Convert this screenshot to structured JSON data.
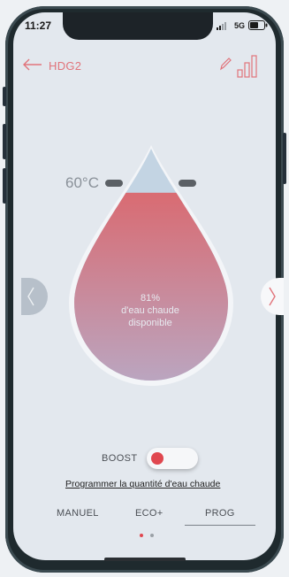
{
  "status_bar": {
    "time": "11:27",
    "network": "5G"
  },
  "header": {
    "title": "HDG2"
  },
  "tank": {
    "temperature": "60°C",
    "percent": "81%",
    "caption_line1": "d'eau chaude",
    "caption_line2": "disponible",
    "fill_fraction": 0.81
  },
  "boost": {
    "label": "BOOST",
    "on": false
  },
  "program_link": "Programmer la quantité d'eau chaude",
  "tabs": [
    {
      "label": "MANUEL"
    },
    {
      "label": "ECO+"
    },
    {
      "label": "PROG"
    }
  ],
  "page_indicator": {
    "count": 2,
    "active": 0
  },
  "colors": {
    "accent": "#e1747b",
    "drop_fill_top": "#d96b72",
    "drop_fill_bottom": "#b8aac6",
    "toggle_knob": "#e0474f"
  }
}
